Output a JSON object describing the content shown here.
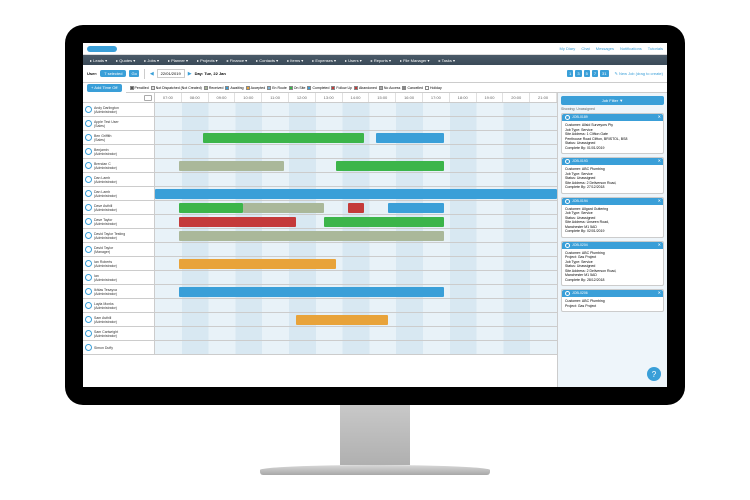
{
  "top_right": [
    "My Diary",
    "Chat",
    "Messages",
    "Notifications",
    "Tutorials"
  ],
  "nav": [
    "Leads",
    "Quotes",
    "Jobs",
    "Planner",
    "Projects",
    "Finance",
    "Contacts",
    "Items",
    "Expenses",
    "Users",
    "Reports",
    "File Manager",
    "Tasks"
  ],
  "control": {
    "user_label": "User:",
    "selected": "7 selected",
    "go": "Go",
    "add_time_off": "+ Add Time Off",
    "date": "22/01/2019",
    "day_label": "Day: Tue, 22 Jan",
    "view_btns": [
      "1",
      "3",
      "5",
      "7",
      "31"
    ],
    "new_job": "New Job (drag to create)"
  },
  "legend": [
    {
      "c": "#555",
      "t": "Pencilled"
    },
    {
      "c": "#ddd",
      "t": "Not Dispatched (Not Created)"
    },
    {
      "c": "#aab89a",
      "t": "Received"
    },
    {
      "c": "#3a9fd8",
      "t": "Awaiting"
    },
    {
      "c": "#e8a33a",
      "t": "Accepted"
    },
    {
      "c": "#7eb5d8",
      "t": "En Route"
    },
    {
      "c": "#3cb54a",
      "t": "On Site"
    },
    {
      "c": "#3a9fd8",
      "t": "Completed"
    },
    {
      "c": "#c43a3a",
      "t": "Follow Up"
    },
    {
      "c": "#c43a3a",
      "t": "Abandoned"
    },
    {
      "c": "#aaa",
      "t": "No Access"
    },
    {
      "c": "#888",
      "t": "Cancelled"
    },
    {
      "c": "#fff",
      "t": "Holiday"
    }
  ],
  "hours": [
    "07:00",
    "08:00",
    "09:00",
    "10:00",
    "11:00",
    "12:00",
    "13:00",
    "14:00",
    "15:00",
    "16:00",
    "17:00",
    "18:00",
    "19:00",
    "20:00",
    "21:00"
  ],
  "users": [
    {
      "n": "Andy Darlington",
      "r": "(Administrator)",
      "bars": []
    },
    {
      "n": "Apple Test User",
      "r": "(Sales)",
      "bars": []
    },
    {
      "n": "Ben Griffith",
      "r": "(Sales)",
      "bars": [
        {
          "s": 12,
          "e": 52,
          "c": "#3cb54a"
        },
        {
          "s": 55,
          "e": 72,
          "c": "#3a9fd8"
        }
      ]
    },
    {
      "n": "Benjamin",
      "r": "(Administrator)",
      "bars": []
    },
    {
      "n": "Brendan C",
      "r": "(Administrator)",
      "bars": [
        {
          "s": 6,
          "e": 32,
          "c": "#aab89a"
        },
        {
          "s": 45,
          "e": 72,
          "c": "#3cb54a"
        }
      ]
    },
    {
      "n": "Dan Lamb",
      "r": "(Administrator)",
      "bars": []
    },
    {
      "n": "Dan Lamb",
      "r": "(Administrator)",
      "bars": [
        {
          "s": 0,
          "e": 100,
          "c": "#3a9fd8"
        }
      ]
    },
    {
      "n": "Dave Asthill",
      "r": "(Administrator)",
      "bars": [
        {
          "s": 6,
          "e": 22,
          "c": "#3cb54a"
        },
        {
          "s": 22,
          "e": 42,
          "c": "#aab89a"
        },
        {
          "s": 48,
          "e": 52,
          "c": "#c43a3a"
        },
        {
          "s": 58,
          "e": 72,
          "c": "#3a9fd8"
        }
      ]
    },
    {
      "n": "Dave Taylor",
      "r": "(Administrator)",
      "bars": [
        {
          "s": 6,
          "e": 35,
          "c": "#c43a3a"
        },
        {
          "s": 42,
          "e": 72,
          "c": "#3cb54a"
        }
      ]
    },
    {
      "n": "David Taylor Testing",
      "r": "(Administrator)",
      "bars": [
        {
          "s": 6,
          "e": 72,
          "c": "#aab89a"
        }
      ]
    },
    {
      "n": "David Taylor",
      "r": "(Manager)",
      "bars": []
    },
    {
      "n": "Ian Roberts",
      "r": "(Administrator)",
      "bars": [
        {
          "s": 6,
          "e": 45,
          "c": "#e8a33a"
        }
      ]
    },
    {
      "n": "Ian",
      "r": "(Administrator)",
      "bars": []
    },
    {
      "n": "Ikhlas Tesayva",
      "r": "(Administrator)",
      "bars": [
        {
          "s": 6,
          "e": 72,
          "c": "#3a9fd8"
        }
      ]
    },
    {
      "n": "Layla Monks",
      "r": "(Administrator)",
      "bars": []
    },
    {
      "n": "Sam Asthill",
      "r": "(Administrator)",
      "bars": [
        {
          "s": 35,
          "e": 58,
          "c": "#e8a33a"
        }
      ]
    },
    {
      "n": "Sam Cartwright",
      "r": "(Administrator)",
      "bars": []
    },
    {
      "n": "Simon Duffy",
      "r": "",
      "bars": []
    }
  ],
  "sidebar": {
    "title": "Job Filter ▼",
    "showing": "Showing: Unassigned",
    "jobs": [
      {
        "id": "JOB-0189",
        "lines": [
          "Customer: Allsid Surveyors Pty",
          "Job Type: Service",
          "Site Address: 1 Clifton Gate",
          "Penthouse Road Clifton, BRISTOL, BS8",
          "Status: Unassigned",
          "Complete By: 01/01/2019"
        ]
      },
      {
        "id": "JOB-0193",
        "lines": [
          "Customer: ABC Plumbing",
          "Job Type: Service",
          "Status: Unassigned",
          "Site Address: 2 Deliverson Road,",
          "Complete By: 27/12/2018"
        ]
      },
      {
        "id": "JOB-0194",
        "lines": [
          "Customer: Allgard Guttering",
          "Job Type: Service",
          "Status: Unassigned",
          "Site Address: Unseen Road,",
          "Manchester M1 5AD",
          "Complete By: 02/01/2019"
        ]
      },
      {
        "id": "JOB-0204",
        "lines": [
          "Customer: ABC Plumbing",
          "Project: Gas Project",
          "Job Type: Service",
          "Status: Unassigned",
          "Site Address: 2 Deliverson Road,",
          "Manchester M1 5AD",
          "Complete By: 28/12/2018"
        ]
      },
      {
        "id": "JOB-0206",
        "lines": [
          "Customer: ABC Plumbing",
          "Project: Gas Project"
        ]
      }
    ]
  },
  "help": "?"
}
